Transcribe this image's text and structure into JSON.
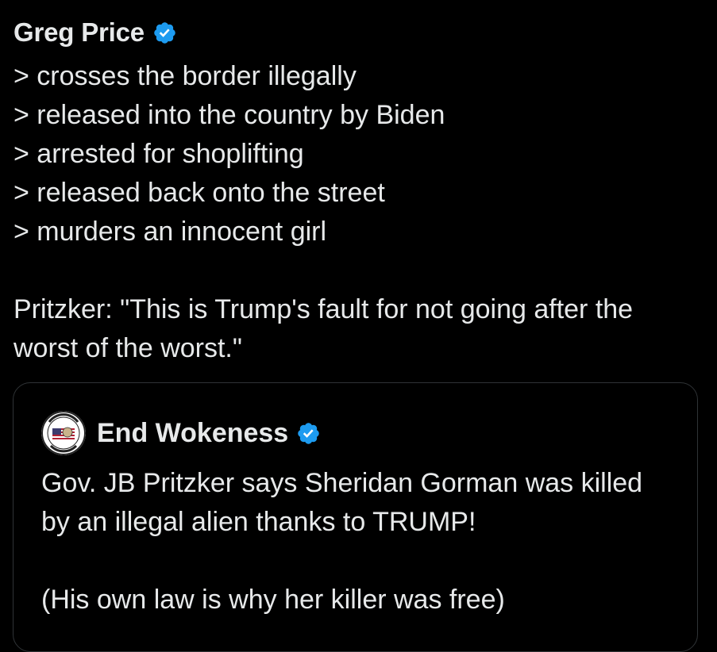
{
  "post": {
    "author_name": "Greg Price",
    "lines": [
      "> crosses the border illegally",
      "> released into the country by Biden",
      "> arrested for shoplifting",
      "> released back onto the street",
      "> murders an innocent girl",
      "",
      "Pritzker: \"This is Trump's fault for not going after the worst of the worst.\""
    ]
  },
  "quote": {
    "author_name": "End Wokeness",
    "lines": [
      "Gov. JB Pritzker says Sheridan Gorman was killed by an illegal alien thanks to TRUMP!",
      "",
      "(His own law is why her killer was free)"
    ]
  },
  "icons": {
    "verified": "verified-badge-icon",
    "avatar": "end-wokeness-logo"
  },
  "colors": {
    "background": "#000000",
    "text": "#e7e9ea",
    "verified_blue": "#1d9bf0",
    "border": "#2f3336"
  }
}
